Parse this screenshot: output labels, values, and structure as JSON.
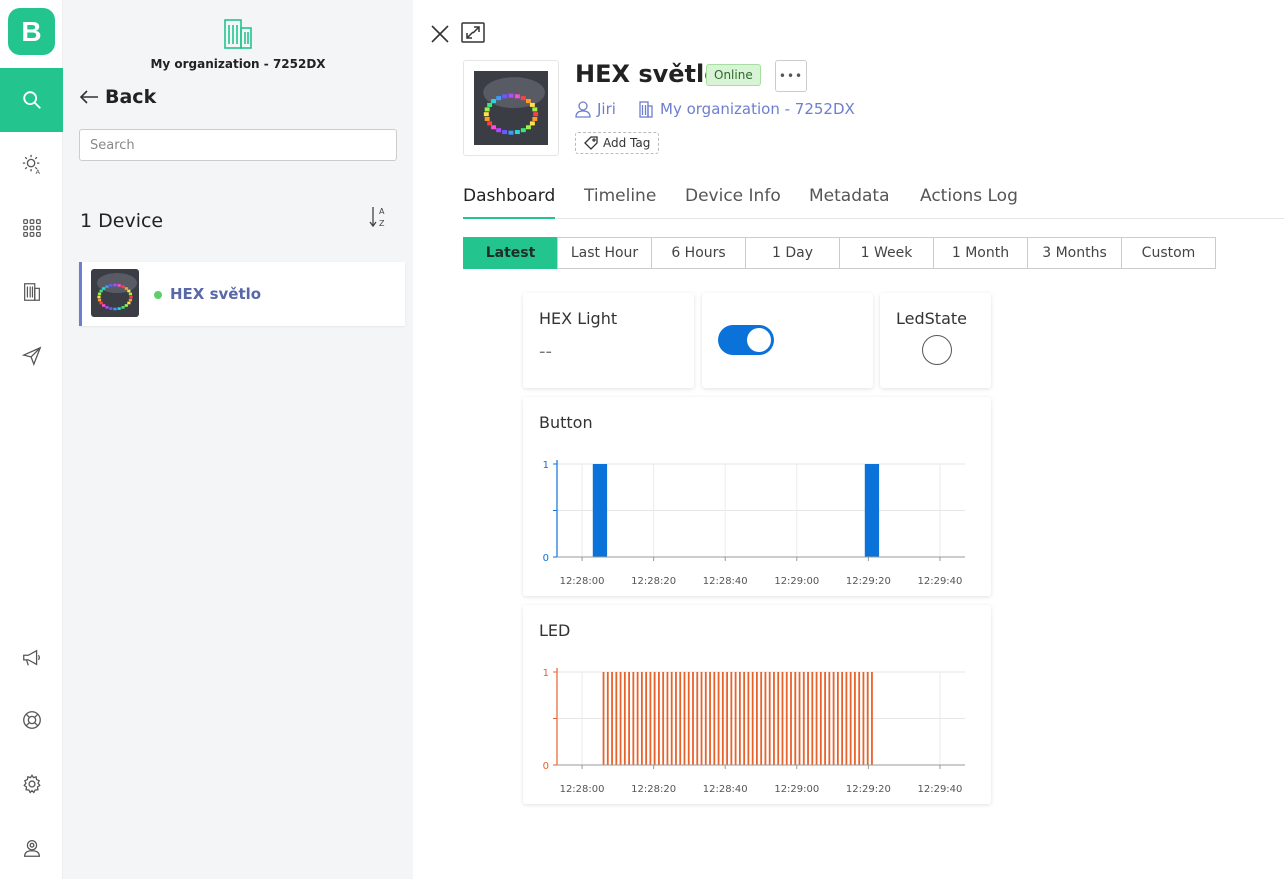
{
  "app": {
    "logo_letter": "B"
  },
  "rail": {
    "items": [
      {
        "icon": "search-icon",
        "active": true
      },
      {
        "icon": "automation-icon"
      },
      {
        "icon": "grid-icon"
      },
      {
        "icon": "building-icon"
      },
      {
        "icon": "send-icon"
      },
      {
        "icon": "megaphone-icon"
      },
      {
        "icon": "lifebuoy-icon"
      },
      {
        "icon": "gear-icon"
      },
      {
        "icon": "user-icon"
      }
    ]
  },
  "panel": {
    "org_name": "My organization - 7252DX",
    "back_label": "Back",
    "search_placeholder": "Search",
    "device_count": "1 Device",
    "devices": [
      {
        "name": "HEX světlo",
        "status": "online"
      }
    ]
  },
  "device": {
    "name": "HEX světlo",
    "status": "Online",
    "more_label": "•••",
    "owner": "Jiri",
    "organization": "My organization - 7252DX",
    "add_tag": "Add Tag"
  },
  "tabs": [
    "Dashboard",
    "Timeline",
    "Device Info",
    "Metadata",
    "Actions Log"
  ],
  "active_tab": "Dashboard",
  "ranges": [
    "Latest",
    "Last Hour",
    "6 Hours",
    "1 Day",
    "1 Week",
    "1 Month",
    "3 Months",
    "Custom"
  ],
  "active_range": "Latest",
  "widgets": {
    "hex_light": {
      "title": "HEX Light",
      "value": "--"
    },
    "switch": {
      "state": "on"
    },
    "ledstate": {
      "title": "LedState"
    },
    "button_chart": {
      "title": "Button"
    },
    "led_chart": {
      "title": "LED"
    }
  },
  "colors": {
    "accent": "#23c48e",
    "button_series": "#0a72d9",
    "led_series": "#e8622b",
    "link": "#6e7ecf"
  },
  "chart_data": [
    {
      "type": "bar",
      "title": "Button",
      "color": "#0a72d9",
      "ylim": [
        0,
        1
      ],
      "yticks": [
        "1",
        "0"
      ],
      "xticks": [
        "12:28:00",
        "12:28:20",
        "12:28:40",
        "12:29:00",
        "12:29:20",
        "12:29:40"
      ],
      "x_range": [
        "12:27:53",
        "12:29:47"
      ],
      "bars": [
        {
          "x_start": "12:28:03",
          "x_end": "12:28:07",
          "value": 1
        },
        {
          "x_start": "12:29:19",
          "x_end": "12:29:23",
          "value": 1
        }
      ]
    },
    {
      "type": "bar",
      "title": "LED",
      "color": "#e8622b",
      "ylim": [
        0,
        1
      ],
      "yticks": [
        "1",
        "0"
      ],
      "xticks": [
        "12:28:00",
        "12:28:20",
        "12:28:40",
        "12:29:00",
        "12:29:20",
        "12:29:40"
      ],
      "x_range": [
        "12:27:53",
        "12:29:47"
      ],
      "pulses": {
        "first": "12:28:06",
        "last": "12:29:21",
        "count": 64,
        "value": 1
      }
    }
  ]
}
